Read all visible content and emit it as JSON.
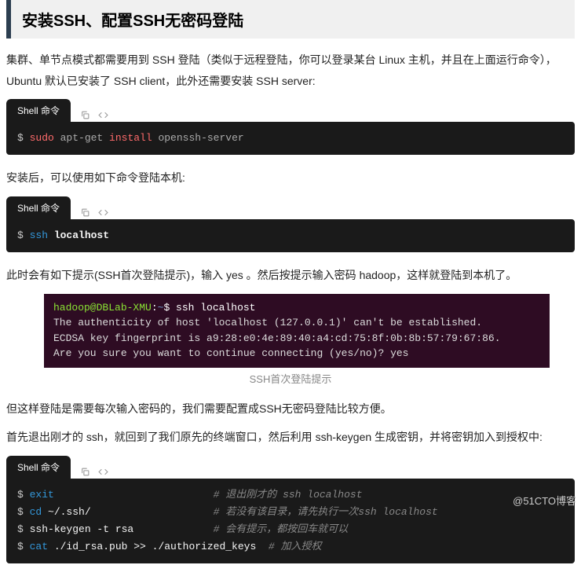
{
  "header": {
    "title": "安装SSH、配置SSH无密码登陆"
  },
  "p1": "集群、单节点模式都需要用到 SSH 登陆（类似于远程登陆，你可以登录某台 Linux 主机，并且在上面运行命令），Ubuntu 默认已安装了 SSH client，此外还需要安装 SSH server:",
  "tab_label": "Shell 命令",
  "code1": {
    "prompt": "$ ",
    "sudo": "sudo",
    "aptget": " apt-get ",
    "install": "install",
    "pkg": " openssh-server"
  },
  "p2": "安装后，可以使用如下命令登陆本机:",
  "code2": {
    "prompt": "$ ",
    "ssh": "ssh",
    "host": " localhost"
  },
  "p3": "此时会有如下提示(SSH首次登陆提示)，输入 yes 。然后按提示输入密码 hadoop，这样就登陆到本机了。",
  "terminal": {
    "l1_user": "hadoop@DBLab-XMU",
    "l1_colon": ":",
    "l1_path": "~",
    "l1_rest": "$ ssh localhost",
    "l2": "The authenticity of host 'localhost (127.0.0.1)' can't be established.",
    "l3": "ECDSA key fingerprint is a9:28:e0:4e:89:40:a4:cd:75:8f:0b:8b:57:79:67:86.",
    "l4": "Are you sure you want to continue connecting (yes/no)? yes"
  },
  "caption1": "SSH首次登陆提示",
  "p4": "但这样登陆是需要每次输入密码的，我们需要配置成SSH无密码登陆比较方便。",
  "p5": "首先退出刚才的 ssh，就回到了我们原先的终端窗口，然后利用 ssh-keygen 生成密钥，并将密钥加入到授权中:",
  "code3": {
    "line1": {
      "prompt": "$ ",
      "cmd": "exit",
      "pad": "                          ",
      "comment": "# 退出刚才的 ssh localhost"
    },
    "line2": {
      "prompt": "$ ",
      "cmd": "cd",
      "arg": " ~/.ssh/",
      "pad": "                    ",
      "comment": "# 若没有该目录，请先执行一次ssh localhost"
    },
    "line3": {
      "prompt": "$ ",
      "cmd": "ssh-keygen -t rsa",
      "pad": "             ",
      "comment": "# 会有提示，都按回车就可以"
    },
    "line4": {
      "prompt": "$ ",
      "cmd": "cat",
      "arg": " ./id_rsa.pub >> ./authorized_keys",
      "pad": "  ",
      "comment": "# 加入授权"
    }
  },
  "watermark": "@51CTO博客"
}
